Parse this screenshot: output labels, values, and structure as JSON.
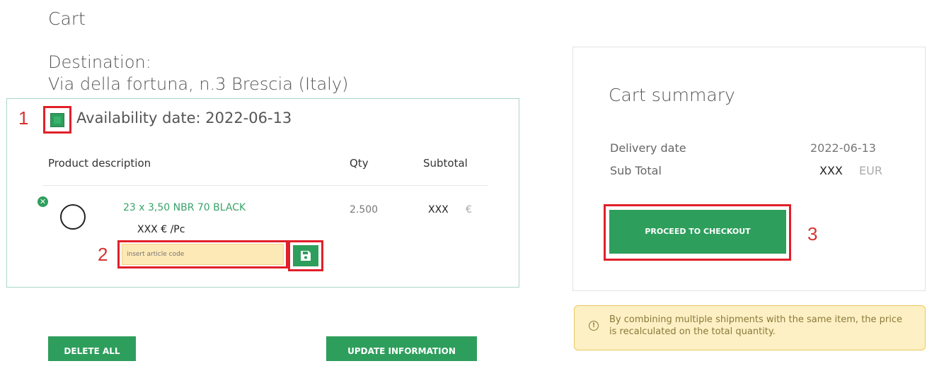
{
  "page": {
    "title": "Cart"
  },
  "destination": {
    "label": "Destination:",
    "address": "Via della fortuna, n.3 Brescia (Italy)"
  },
  "annotations": {
    "n1": "1",
    "n2": "2",
    "n3": "3"
  },
  "group": {
    "availability": "Availability date: 2022-06-13",
    "selected": true
  },
  "table": {
    "headers": {
      "product": "Product description",
      "qty": "Qty",
      "subtotal": "Subtotal"
    },
    "rows": [
      {
        "name": "23 x 3,50 NBR 70 BLACK",
        "unit_price": "XXX  € /Pc",
        "qty": "2.500",
        "subtotal": "XXX",
        "currency": "€"
      }
    ]
  },
  "article_code": {
    "placeholder": "insert article code",
    "value": ""
  },
  "buttons": {
    "delete_all": "DELETE ALL",
    "update_info": "UPDATE INFORMATION",
    "checkout": "PROCEED TO CHECKOUT"
  },
  "summary": {
    "title": "Cart summary",
    "delivery_label": "Delivery date",
    "delivery_value": "2022-06-13",
    "subtotal_label": "Sub Total",
    "subtotal_value": "XXX",
    "subtotal_currency": "EUR"
  },
  "notice": {
    "icon": "info-icon",
    "text": "By combining multiple shipments with the same item, the price is recalculated on the total quantity."
  },
  "icons": {
    "remove": "close-icon",
    "save": "save-icon",
    "product": "product-circle"
  },
  "colors": {
    "accent": "#2e9e5c",
    "highlight": "#e0202a",
    "notice_bg": "#fdf0c4",
    "input_bg": "#fde9b6"
  }
}
